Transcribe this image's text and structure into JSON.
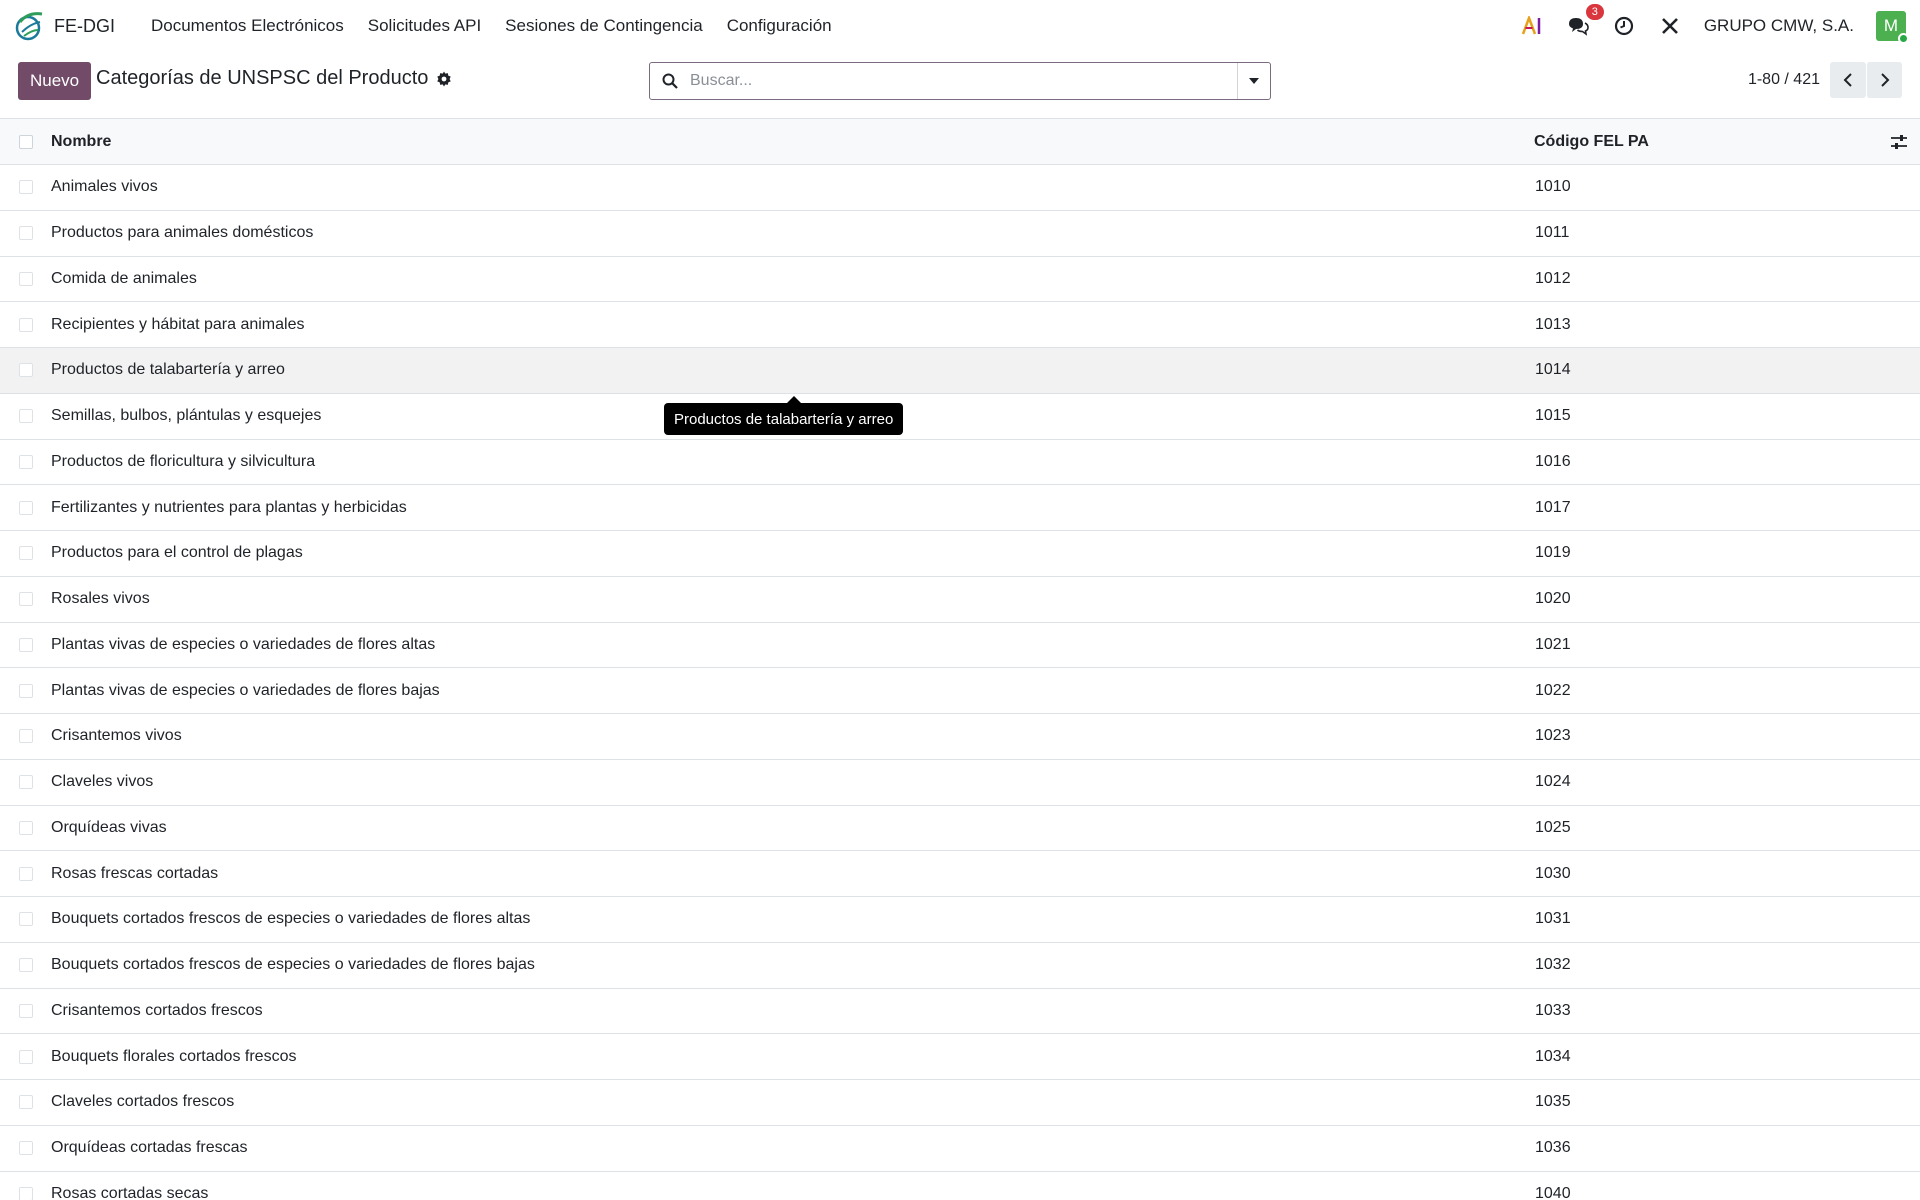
{
  "navbar": {
    "app_name": "FE-DGI",
    "menu": [
      "Documentos Electrónicos",
      "Solicitudes API",
      "Sesiones de Contingencia",
      "Configuración"
    ],
    "messages_badge": "3",
    "company": "GRUPO CMW, S.A.",
    "avatar_letter": "M",
    "icons": [
      "ai-icon",
      "chat-icon",
      "clock-icon",
      "tools-icon"
    ]
  },
  "control": {
    "new_label": "Nuevo",
    "title": "Categorías de UNSPSC del Producto",
    "search_placeholder": "Buscar...",
    "pager": "1-80 / 421"
  },
  "table": {
    "columns": [
      "Nombre",
      "Código FEL PA"
    ],
    "rows": [
      {
        "name": "Animales vivos",
        "code": "1010"
      },
      {
        "name": "Productos para animales domésticos",
        "code": "1011"
      },
      {
        "name": "Comida de animales",
        "code": "1012"
      },
      {
        "name": "Recipientes y hábitat para animales",
        "code": "1013"
      },
      {
        "name": "Productos de talabartería y arreo",
        "code": "1014"
      },
      {
        "name": "Semillas, bulbos, plántulas y esquejes",
        "code": "1015"
      },
      {
        "name": "Productos de floricultura y silvicultura",
        "code": "1016"
      },
      {
        "name": "Fertilizantes y nutrientes para plantas y herbicidas",
        "code": "1017"
      },
      {
        "name": "Productos para el control de plagas",
        "code": "1019"
      },
      {
        "name": "Rosales vivos",
        "code": "1020"
      },
      {
        "name": "Plantas vivas de especies o variedades de flores altas",
        "code": "1021"
      },
      {
        "name": "Plantas vivas de especies o variedades de flores bajas",
        "code": "1022"
      },
      {
        "name": "Crisantemos vivos",
        "code": "1023"
      },
      {
        "name": "Claveles vivos",
        "code": "1024"
      },
      {
        "name": "Orquídeas vivas",
        "code": "1025"
      },
      {
        "name": "Rosas frescas cortadas",
        "code": "1030"
      },
      {
        "name": "Bouquets cortados frescos de especies o variedades de flores altas",
        "code": "1031"
      },
      {
        "name": "Bouquets cortados frescos de especies o variedades de flores bajas",
        "code": "1032"
      },
      {
        "name": "Crisantemos cortados frescos",
        "code": "1033"
      },
      {
        "name": "Bouquets florales cortados frescos",
        "code": "1034"
      },
      {
        "name": "Claveles cortados frescos",
        "code": "1035"
      },
      {
        "name": "Orquídeas cortadas frescas",
        "code": "1036"
      },
      {
        "name": "Rosas cortadas secas",
        "code": "1040"
      }
    ]
  },
  "tooltip": "Productos de talabartería y arreo",
  "colors": {
    "primary": "#714b67",
    "badge": "#d9363e",
    "avatar": "#4caf50"
  }
}
